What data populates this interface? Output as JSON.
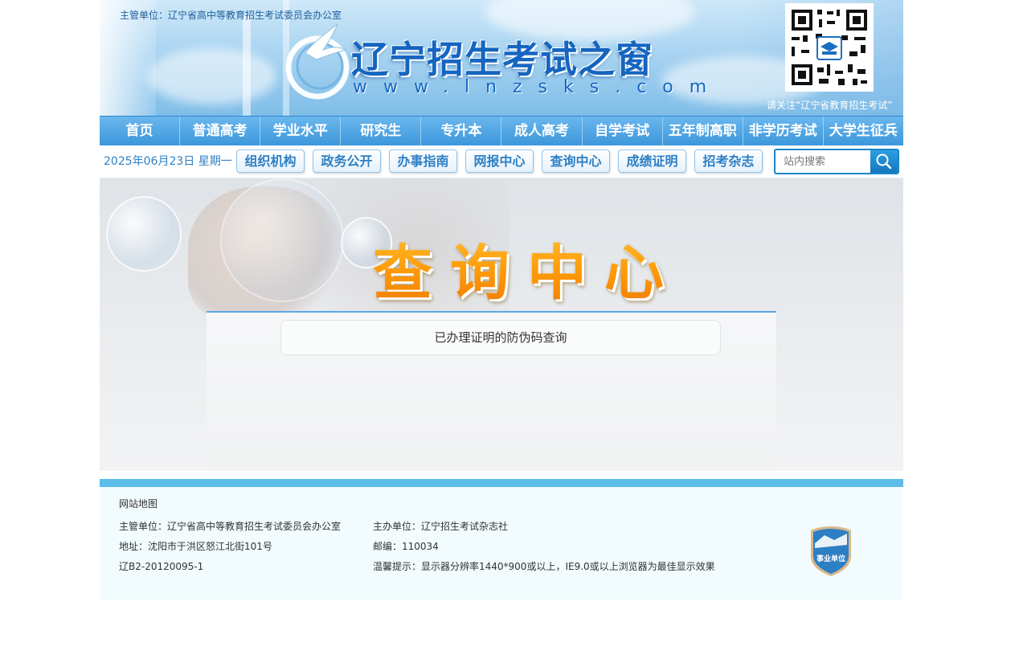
{
  "header": {
    "supervisor": "主管单位：辽宁省高中等教育招生考试委员会办公室",
    "site_title": "辽宁招生考试之窗",
    "site_url": "www.lnzsks.com",
    "qr_caption": "请关注“辽宁省教育招生考试”"
  },
  "main_nav": [
    {
      "label": "首页"
    },
    {
      "label": "普通高考"
    },
    {
      "label": "学业水平"
    },
    {
      "label": "研究生"
    },
    {
      "label": "专升本"
    },
    {
      "label": "成人高考"
    },
    {
      "label": "自学考试"
    },
    {
      "label": "五年制高职"
    },
    {
      "label": "非学历考试"
    },
    {
      "label": "大学生征兵"
    }
  ],
  "sub_nav": {
    "date": "2025年06月23日 星期一",
    "buttons": [
      {
        "label": "组织机构"
      },
      {
        "label": "政务公开"
      },
      {
        "label": "办事指南"
      },
      {
        "label": "网报中心"
      },
      {
        "label": "查询中心"
      },
      {
        "label": "成绩证明"
      },
      {
        "label": "招考杂志"
      }
    ],
    "search_placeholder": "站内搜索"
  },
  "banner": {
    "heading": "查询中心"
  },
  "content": {
    "query_item": "已办理证明的防伪码查询"
  },
  "footer": {
    "sitemap": "网站地图",
    "supervisor": "主管单位：辽宁省高中等教育招生考试委员会办公室",
    "sponsor": "主办单位：辽宁招生考试杂志社",
    "address": "地址：沈阳市于洪区怒江北街101号",
    "postcode": "邮编：110034",
    "license": "辽B2-20120095-1",
    "tip": "温馨提示：显示器分辨率1440*900或以上，IE9.0或以上浏览器为最佳显示效果",
    "badge_text": "事业单位"
  },
  "colors": {
    "nav_blue": "#3c97db",
    "accent_orange": "#f59a12",
    "footer_bar": "#5bbde8"
  }
}
